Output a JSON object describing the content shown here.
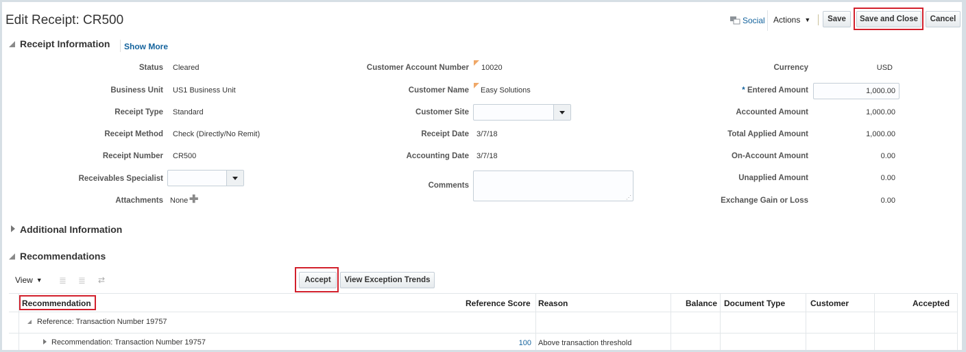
{
  "header": {
    "title": "Edit Receipt: CR500",
    "social_label": "Social",
    "actions_label": "Actions",
    "save_label": "Save",
    "save_close_label": "Save and Close",
    "cancel_label": "Cancel"
  },
  "receipt_info": {
    "heading": "Receipt Information",
    "show_more": "Show More",
    "col1": [
      {
        "label": "Status",
        "value": "Cleared"
      },
      {
        "label": "Business Unit",
        "value": "US1 Business Unit"
      },
      {
        "label": "Receipt Type",
        "value": "Standard"
      },
      {
        "label": "Receipt Method",
        "value": "Check (Directly/No Remit)"
      },
      {
        "label": "Receipt Number",
        "value": "CR500"
      },
      {
        "label": "Receivables Specialist",
        "value": ""
      },
      {
        "label": "Attachments",
        "value": "None"
      }
    ],
    "col2": [
      {
        "label": "Customer Account Number",
        "value": "10020"
      },
      {
        "label": "Customer Name",
        "value": "Easy Solutions"
      },
      {
        "label": "Customer Site",
        "value": ""
      },
      {
        "label": "Receipt Date",
        "value": "3/7/18"
      },
      {
        "label": "Accounting Date",
        "value": "3/7/18"
      },
      {
        "label": "Comments",
        "value": ""
      }
    ],
    "col3": [
      {
        "label": "Currency",
        "value": "USD"
      },
      {
        "label": "Entered Amount",
        "value": "1,000.00",
        "required": "*"
      },
      {
        "label": "Accounted Amount",
        "value": "1,000.00"
      },
      {
        "label": "Total Applied Amount",
        "value": "1,000.00"
      },
      {
        "label": "On-Account Amount",
        "value": "0.00"
      },
      {
        "label": "Unapplied Amount",
        "value": "0.00"
      },
      {
        "label": "Exchange Gain or Loss",
        "value": "0.00"
      }
    ]
  },
  "additional_info": {
    "heading": "Additional Information"
  },
  "recommendations": {
    "heading": "Recommendations",
    "view_label": "View",
    "accept_label": "Accept",
    "trends_label": "View Exception Trends",
    "columns": [
      "Recommendation",
      "Reference Score",
      "Reason",
      "Balance",
      "Document Type",
      "Customer",
      "Accepted"
    ],
    "rows": [
      {
        "recommendation": "Reference: Transaction Number 19757",
        "score": "",
        "reason": ""
      },
      {
        "recommendation": "Recommendation: Transaction Number 19757",
        "score": "100",
        "reason": "Above transaction threshold"
      }
    ]
  }
}
